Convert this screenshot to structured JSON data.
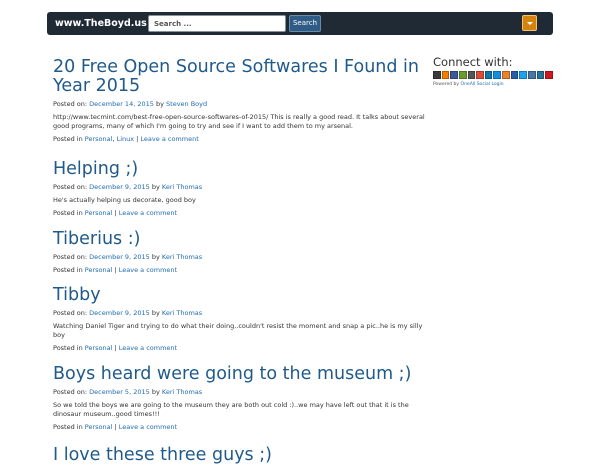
{
  "navbar": {
    "brand": "www.TheBoyd.us",
    "search_placeholder": "Search ...",
    "search_button": "Search"
  },
  "posts": [
    {
      "title": "20 Free Open Source Softwares I Found in Year 2015",
      "posted_on_label": "Posted on:",
      "date": "December 14, 2015",
      "by_label": "by",
      "author": "Steven Boyd",
      "excerpt": "http://www.tecmint.com/best-free-open-source-softwares-of-2015/ This is really a good read. It talks about several good programs, many of which I'm going to try and see if I want to add them to my arsenal.",
      "posted_in_label": "Posted in",
      "categories": [
        "Personal",
        "Linux"
      ],
      "comment_label": "Leave a comment"
    },
    {
      "title": "Helping ;)",
      "posted_on_label": "Posted on:",
      "date": "December 9, 2015",
      "by_label": "by",
      "author": "Keri Thomas",
      "excerpt": "He's actually helping us decorate, good boy",
      "posted_in_label": "Posted in",
      "categories": [
        "Personal"
      ],
      "comment_label": "Leave a comment"
    },
    {
      "title": "Tiberius :)",
      "posted_on_label": "Posted on:",
      "date": "December 9, 2015",
      "by_label": "by",
      "author": "Keri Thomas",
      "excerpt": "",
      "posted_in_label": "Posted in",
      "categories": [
        "Personal"
      ],
      "comment_label": "Leave a comment"
    },
    {
      "title": "Tibby",
      "posted_on_label": "Posted on:",
      "date": "December 9, 2015",
      "by_label": "by",
      "author": "Keri Thomas",
      "excerpt": "Watching Daniel Tiger and trying to do what their doing..couldn't resist the moment and snap a pic..he is my silly boy",
      "posted_in_label": "Posted in",
      "categories": [
        "Personal"
      ],
      "comment_label": "Leave a comment"
    },
    {
      "title": "Boys heard were going to the museum ;)",
      "posted_on_label": "Posted on:",
      "date": "December 5, 2015",
      "by_label": "by",
      "author": "Keri Thomas",
      "excerpt": "So we told the boys we are going to the museum they are both out cold :)..we may have left out that it is the dinosaur museum..good times!!!",
      "posted_in_label": "Posted in",
      "categories": [
        "Personal"
      ],
      "comment_label": "Leave a comment"
    },
    {
      "title": "I love these three guys ;)",
      "posted_on_label": "",
      "date": "",
      "by_label": "",
      "author": "",
      "excerpt": "",
      "posted_in_label": "",
      "categories": [],
      "comment_label": ""
    }
  ],
  "sidebar": {
    "connect_title": "Connect with:",
    "social_icons": [
      {
        "name": "amazon-icon",
        "color": "#3b3b3b"
      },
      {
        "name": "blogger-icon",
        "color": "#f57d00"
      },
      {
        "name": "facebook-icon",
        "color": "#3b5998"
      },
      {
        "name": "foursquare-icon",
        "color": "#6b9b2f"
      },
      {
        "name": "github-icon",
        "color": "#555555"
      },
      {
        "name": "google-icon",
        "color": "#dd4b39"
      },
      {
        "name": "linkedin-icon",
        "color": "#0e76a8"
      },
      {
        "name": "mailru-icon",
        "color": "#168de2"
      },
      {
        "name": "odnoklassniki-icon",
        "color": "#ed812b"
      },
      {
        "name": "paypal-icon",
        "color": "#2a5da8"
      },
      {
        "name": "twitter-icon",
        "color": "#1da1f2"
      },
      {
        "name": "vkontakte-icon",
        "color": "#4c75a3"
      },
      {
        "name": "wordpress-icon",
        "color": "#21759b"
      },
      {
        "name": "youtube-icon",
        "color": "#cc181e"
      }
    ],
    "powered_prefix": "Powered by",
    "powered_link": "OneAll Social Login"
  },
  "colors": {
    "navbar_bg": "#1f2a35",
    "title_link": "#1f5a8a",
    "meta_link": "#1f6cb0",
    "search_button_bg": "#2f5c86",
    "menu_toggle_bg": "#d4830c"
  }
}
